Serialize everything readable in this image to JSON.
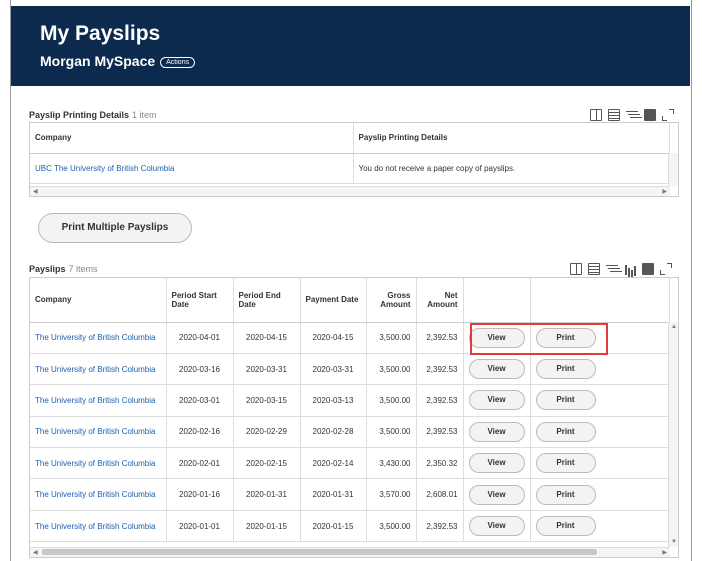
{
  "header": {
    "title": "My Payslips",
    "subtitle": "Morgan MySpace",
    "actions_label": "Actions"
  },
  "printing_details": {
    "title": "Payslip Printing Details",
    "count": "1 item",
    "columns": [
      "Company",
      "Payslip Printing Details"
    ],
    "rows": [
      {
        "company": "UBC The University of British Columbia",
        "details": "You do not receive a paper copy of payslips."
      }
    ]
  },
  "print_multiple_label": "Print Multiple Payslips",
  "payslips": {
    "title": "Payslips",
    "count": "7 items",
    "columns": {
      "company": "Company",
      "period_start": "Period Start Date",
      "period_end": "Period End Date",
      "payment_date": "Payment Date",
      "gross": "Gross Amount",
      "net": "Net Amount"
    },
    "view_label": "View",
    "print_label": "Print",
    "rows": [
      {
        "company": "The University of British Columbia",
        "start": "2020-04-01",
        "end": "2020-04-15",
        "pay": "2020-04-15",
        "gross": "3,500.00",
        "net": "2,392.53"
      },
      {
        "company": "The University of British Columbia",
        "start": "2020-03-16",
        "end": "2020-03-31",
        "pay": "2020-03-31",
        "gross": "3,500.00",
        "net": "2,392.53"
      },
      {
        "company": "The University of British Columbia",
        "start": "2020-03-01",
        "end": "2020-03-15",
        "pay": "2020-03-13",
        "gross": "3,500.00",
        "net": "2,392.53"
      },
      {
        "company": "The University of British Columbia",
        "start": "2020-02-16",
        "end": "2020-02-29",
        "pay": "2020-02-28",
        "gross": "3,500.00",
        "net": "2,392.53"
      },
      {
        "company": "The University of British Columbia",
        "start": "2020-02-01",
        "end": "2020-02-15",
        "pay": "2020-02-14",
        "gross": "3,430.00",
        "net": "2,350.32"
      },
      {
        "company": "The University of British Columbia",
        "start": "2020-01-16",
        "end": "2020-01-31",
        "pay": "2020-01-31",
        "gross": "3,570.00",
        "net": "2,608.01"
      },
      {
        "company": "The University of British Columbia",
        "start": "2020-01-01",
        "end": "2020-01-15",
        "pay": "2020-01-15",
        "gross": "3,500.00",
        "net": "2,392.53"
      }
    ]
  },
  "colors": {
    "header_bg": "#0b2a4d",
    "link": "#1f5fb3",
    "highlight": "#e23b3b"
  },
  "icons": [
    "split-view-icon",
    "list-view-icon",
    "filter-icon",
    "chart-icon",
    "columns-icon",
    "fullscreen-icon"
  ]
}
